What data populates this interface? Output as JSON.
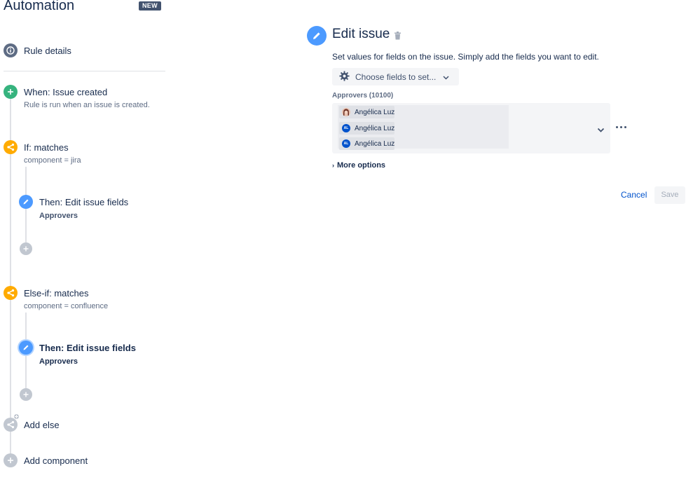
{
  "header": {
    "title": "Automation",
    "badge": "NEW"
  },
  "steps": [
    {
      "title": "Rule details",
      "icon": "info-icon"
    },
    {
      "title": "When: Issue created",
      "subtitle": "Rule is run when an issue is created.",
      "icon": "plus-icon"
    },
    {
      "title": "If: matches",
      "subtitle": "component = jira",
      "icon": "branch-icon"
    },
    {
      "title": "Then: Edit issue fields",
      "subtitle": "Approvers",
      "icon": "pencil-icon"
    },
    {
      "title": "Else-if: matches",
      "subtitle": "component = confluence",
      "icon": "branch-icon"
    },
    {
      "title": "Then: Edit issue fields",
      "subtitle": "Approvers",
      "icon": "pencil-icon",
      "selected": true
    },
    {
      "title": "Add else",
      "icon": "branch-add-icon"
    },
    {
      "title": "Add component",
      "icon": "plus-icon"
    }
  ],
  "panel": {
    "title": "Edit issue",
    "description": "Set values for fields on the issue. Simply add the fields you want to edit.",
    "choose_fields_label": "Choose fields to set...",
    "field": {
      "label": "Approvers (10100)",
      "values": [
        {
          "name": "Angélica Luz",
          "avatar": "photo"
        },
        {
          "name": "Angélica Luz",
          "avatar": "AL"
        },
        {
          "name": "Angélica Luz",
          "avatar": "AL"
        }
      ]
    },
    "more_options_label": "More options",
    "cancel_label": "Cancel",
    "save_label": "Save"
  },
  "colors": {
    "trigger": "#36B37E",
    "condition": "#FFAB00",
    "action": "#4C9AFF",
    "link": "#0052CC",
    "text": "#172B4D",
    "muted": "#5E6C84"
  }
}
